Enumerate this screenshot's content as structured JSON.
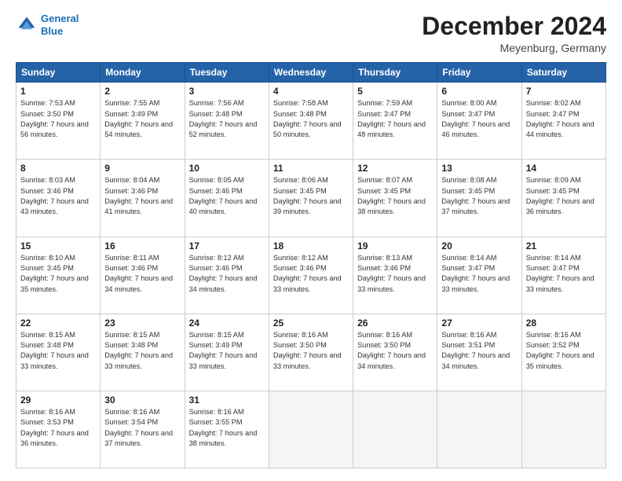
{
  "header": {
    "logo_line1": "General",
    "logo_line2": "Blue",
    "month": "December 2024",
    "location": "Meyenburg, Germany"
  },
  "days_of_week": [
    "Sunday",
    "Monday",
    "Tuesday",
    "Wednesday",
    "Thursday",
    "Friday",
    "Saturday"
  ],
  "weeks": [
    [
      {
        "day": 1,
        "sunrise": "7:53 AM",
        "sunset": "3:50 PM",
        "daylight": "7 hours and 56 minutes."
      },
      {
        "day": 2,
        "sunrise": "7:55 AM",
        "sunset": "3:49 PM",
        "daylight": "7 hours and 54 minutes."
      },
      {
        "day": 3,
        "sunrise": "7:56 AM",
        "sunset": "3:48 PM",
        "daylight": "7 hours and 52 minutes."
      },
      {
        "day": 4,
        "sunrise": "7:58 AM",
        "sunset": "3:48 PM",
        "daylight": "7 hours and 50 minutes."
      },
      {
        "day": 5,
        "sunrise": "7:59 AM",
        "sunset": "3:47 PM",
        "daylight": "7 hours and 48 minutes."
      },
      {
        "day": 6,
        "sunrise": "8:00 AM",
        "sunset": "3:47 PM",
        "daylight": "7 hours and 46 minutes."
      },
      {
        "day": 7,
        "sunrise": "8:02 AM",
        "sunset": "3:47 PM",
        "daylight": "7 hours and 44 minutes."
      }
    ],
    [
      {
        "day": 8,
        "sunrise": "8:03 AM",
        "sunset": "3:46 PM",
        "daylight": "7 hours and 43 minutes."
      },
      {
        "day": 9,
        "sunrise": "8:04 AM",
        "sunset": "3:46 PM",
        "daylight": "7 hours and 41 minutes."
      },
      {
        "day": 10,
        "sunrise": "8:05 AM",
        "sunset": "3:46 PM",
        "daylight": "7 hours and 40 minutes."
      },
      {
        "day": 11,
        "sunrise": "8:06 AM",
        "sunset": "3:45 PM",
        "daylight": "7 hours and 39 minutes."
      },
      {
        "day": 12,
        "sunrise": "8:07 AM",
        "sunset": "3:45 PM",
        "daylight": "7 hours and 38 minutes."
      },
      {
        "day": 13,
        "sunrise": "8:08 AM",
        "sunset": "3:45 PM",
        "daylight": "7 hours and 37 minutes."
      },
      {
        "day": 14,
        "sunrise": "8:09 AM",
        "sunset": "3:45 PM",
        "daylight": "7 hours and 36 minutes."
      }
    ],
    [
      {
        "day": 15,
        "sunrise": "8:10 AM",
        "sunset": "3:45 PM",
        "daylight": "7 hours and 35 minutes."
      },
      {
        "day": 16,
        "sunrise": "8:11 AM",
        "sunset": "3:46 PM",
        "daylight": "7 hours and 34 minutes."
      },
      {
        "day": 17,
        "sunrise": "8:12 AM",
        "sunset": "3:46 PM",
        "daylight": "7 hours and 34 minutes."
      },
      {
        "day": 18,
        "sunrise": "8:12 AM",
        "sunset": "3:46 PM",
        "daylight": "7 hours and 33 minutes."
      },
      {
        "day": 19,
        "sunrise": "8:13 AM",
        "sunset": "3:46 PM",
        "daylight": "7 hours and 33 minutes."
      },
      {
        "day": 20,
        "sunrise": "8:14 AM",
        "sunset": "3:47 PM",
        "daylight": "7 hours and 33 minutes."
      },
      {
        "day": 21,
        "sunrise": "8:14 AM",
        "sunset": "3:47 PM",
        "daylight": "7 hours and 33 minutes."
      }
    ],
    [
      {
        "day": 22,
        "sunrise": "8:15 AM",
        "sunset": "3:48 PM",
        "daylight": "7 hours and 33 minutes."
      },
      {
        "day": 23,
        "sunrise": "8:15 AM",
        "sunset": "3:48 PM",
        "daylight": "7 hours and 33 minutes."
      },
      {
        "day": 24,
        "sunrise": "8:15 AM",
        "sunset": "3:49 PM",
        "daylight": "7 hours and 33 minutes."
      },
      {
        "day": 25,
        "sunrise": "8:16 AM",
        "sunset": "3:50 PM",
        "daylight": "7 hours and 33 minutes."
      },
      {
        "day": 26,
        "sunrise": "8:16 AM",
        "sunset": "3:50 PM",
        "daylight": "7 hours and 34 minutes."
      },
      {
        "day": 27,
        "sunrise": "8:16 AM",
        "sunset": "3:51 PM",
        "daylight": "7 hours and 34 minutes."
      },
      {
        "day": 28,
        "sunrise": "8:16 AM",
        "sunset": "3:52 PM",
        "daylight": "7 hours and 35 minutes."
      }
    ],
    [
      {
        "day": 29,
        "sunrise": "8:16 AM",
        "sunset": "3:53 PM",
        "daylight": "7 hours and 36 minutes."
      },
      {
        "day": 30,
        "sunrise": "8:16 AM",
        "sunset": "3:54 PM",
        "daylight": "7 hours and 37 minutes."
      },
      {
        "day": 31,
        "sunrise": "8:16 AM",
        "sunset": "3:55 PM",
        "daylight": "7 hours and 38 minutes."
      },
      null,
      null,
      null,
      null
    ]
  ]
}
